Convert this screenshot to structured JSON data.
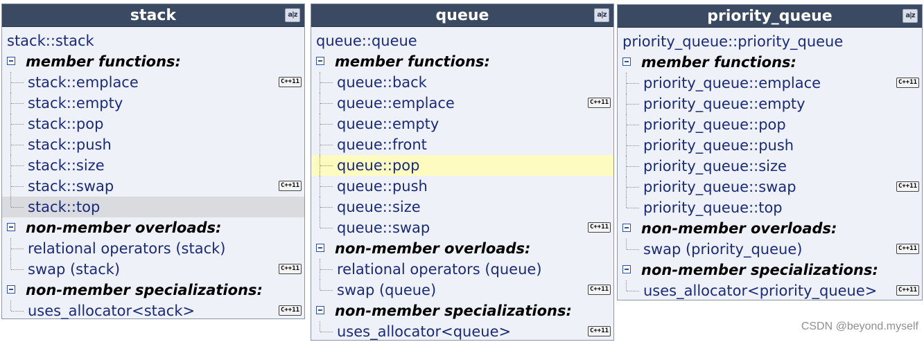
{
  "panels": [
    {
      "title": "stack",
      "sort_icon": "a|z",
      "constructor": "stack::stack",
      "groups": [
        {
          "label": "member functions:",
          "items": [
            {
              "label": "stack::emplace",
              "cpp11": true
            },
            {
              "label": "stack::empty"
            },
            {
              "label": "stack::pop"
            },
            {
              "label": "stack::push"
            },
            {
              "label": "stack::size"
            },
            {
              "label": "stack::swap",
              "cpp11": true
            },
            {
              "label": "stack::top",
              "highlight": "gray"
            }
          ]
        },
        {
          "label": "non-member overloads:",
          "items": [
            {
              "label": "relational operators (stack)"
            },
            {
              "label": "swap (stack)",
              "cpp11": true
            }
          ]
        },
        {
          "label": "non-member specializations:",
          "items": [
            {
              "label": "uses_allocator<stack>",
              "cpp11": true
            }
          ]
        }
      ]
    },
    {
      "title": "queue",
      "sort_icon": "a|z",
      "constructor": "queue::queue",
      "groups": [
        {
          "label": "member functions:",
          "items": [
            {
              "label": "queue::back"
            },
            {
              "label": "queue::emplace",
              "cpp11": true
            },
            {
              "label": "queue::empty"
            },
            {
              "label": "queue::front"
            },
            {
              "label": "queue::pop",
              "highlight": "yellow"
            },
            {
              "label": "queue::push"
            },
            {
              "label": "queue::size"
            },
            {
              "label": "queue::swap",
              "cpp11": true
            }
          ]
        },
        {
          "label": "non-member overloads:",
          "items": [
            {
              "label": "relational operators (queue)"
            },
            {
              "label": "swap (queue)",
              "cpp11": true
            }
          ]
        },
        {
          "label": "non-member specializations:",
          "items": [
            {
              "label": "uses_allocator<queue>",
              "cpp11": true
            }
          ]
        }
      ]
    },
    {
      "title": "priority_queue",
      "sort_icon": "a|z",
      "constructor": "priority_queue::priority_queue",
      "groups": [
        {
          "label": "member functions:",
          "items": [
            {
              "label": "priority_queue::emplace",
              "cpp11": true
            },
            {
              "label": "priority_queue::empty"
            },
            {
              "label": "priority_queue::pop"
            },
            {
              "label": "priority_queue::push"
            },
            {
              "label": "priority_queue::size"
            },
            {
              "label": "priority_queue::swap",
              "cpp11": true
            },
            {
              "label": "priority_queue::top"
            }
          ]
        },
        {
          "label": "non-member overloads:",
          "items": [
            {
              "label": "swap (priority_queue)",
              "cpp11": true
            }
          ]
        },
        {
          "label": "non-member specializations:",
          "items": [
            {
              "label": "uses_allocator<priority_queue>",
              "cpp11": true
            }
          ]
        }
      ]
    }
  ],
  "badge_text": "C++11",
  "watermark": "CSDN @beyond.myself"
}
